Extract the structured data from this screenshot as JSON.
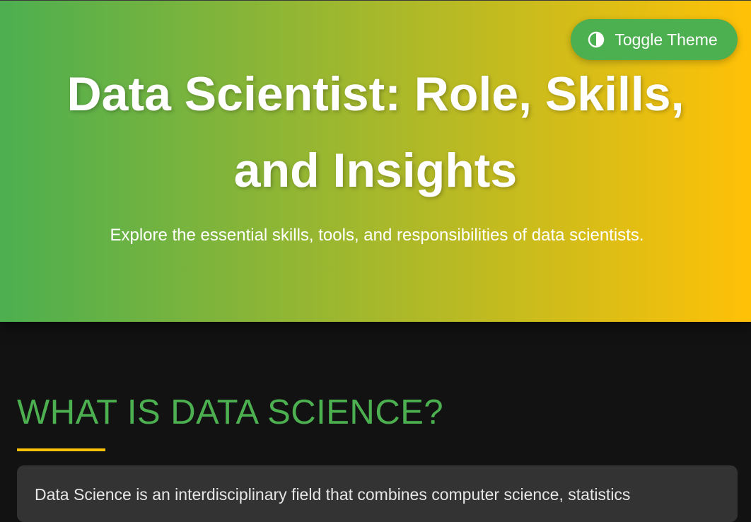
{
  "header": {
    "toggle_label": "Toggle Theme",
    "toggle_icon": "half-circle-contrast-icon",
    "title": "Data Scientist: Role, Skills, and Insights",
    "subtitle": "Explore the essential skills, tools, and responsibilities of data scientists.",
    "gradient_start": "#4caf50",
    "gradient_end": "#ffc107"
  },
  "section": {
    "heading": "WHAT IS DATA SCIENCE?",
    "heading_color": "#4caf50",
    "underline_color": "#ffc107",
    "card_text": "Data Science is an interdisciplinary field that combines computer science, statistics"
  }
}
